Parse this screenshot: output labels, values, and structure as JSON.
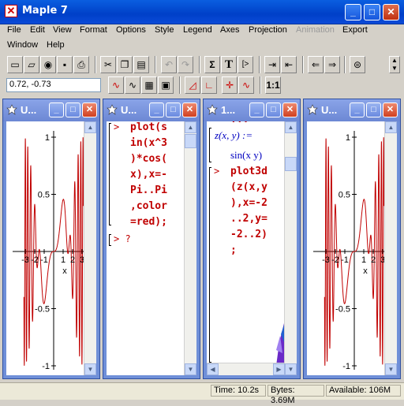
{
  "app": {
    "title": "Maple 7"
  },
  "menu": {
    "row1": [
      "File",
      "Edit",
      "View",
      "Format",
      "Options",
      "Style",
      "Legend",
      "Axes",
      "Projection",
      "Animation",
      "Export"
    ],
    "row2": [
      "Window",
      "Help"
    ],
    "disabled": "Animation"
  },
  "toolbar": {
    "icons": [
      "new-icon",
      "open-icon",
      "open-url-icon",
      "save-icon",
      "print-icon",
      "cut-icon",
      "copy-icon",
      "paste-icon",
      "undo-icon",
      "redo-icon",
      "sum-icon",
      "text-icon",
      "exec-group-icon",
      "indent-icon",
      "outdent-icon",
      "back-icon",
      "forward-icon",
      "stop-icon"
    ],
    "sum_label": "Σ",
    "text_label": "T",
    "exec_label": "[>"
  },
  "plot_toolbar": {
    "coord_value": "0.72, -0.73",
    "one_to_one_label": "1:1"
  },
  "windows": [
    {
      "title": "U..."
    },
    {
      "title": "U..."
    },
    {
      "title": "1..."
    },
    {
      "title": "U..."
    }
  ],
  "plot": {
    "y_ticks": [
      "1",
      "0.5",
      "-0.5",
      "-1"
    ],
    "x_ticks": [
      "-3",
      "-2",
      "-1",
      "1",
      "2",
      "3"
    ],
    "x_label": "x"
  },
  "worksheet2": {
    "prompt": ">",
    "lines": [
      "plot(s",
      "in(x^3",
      ")*cos(",
      "x),x=-",
      "Pi..Pi",
      ",color",
      "=red);"
    ],
    "empty_prompt": "> ?"
  },
  "worksheet3": {
    "top_cut": "...",
    "def_line": "z(x, y) :=",
    "def_body": "sin(x y)",
    "prompt": ">",
    "lines": [
      "plot3d",
      "(z(x,y",
      "),x=-2",
      "..2,y=",
      "-2..2)",
      ";"
    ]
  },
  "status": {
    "time": "Time:  10.2s",
    "bytes": "Bytes: 3.69M",
    "available": "Available: 106M"
  },
  "colors": {
    "titlebar": "#0040c8",
    "input": "#c00000",
    "output": "#0000c0",
    "plot": "#c00000"
  }
}
